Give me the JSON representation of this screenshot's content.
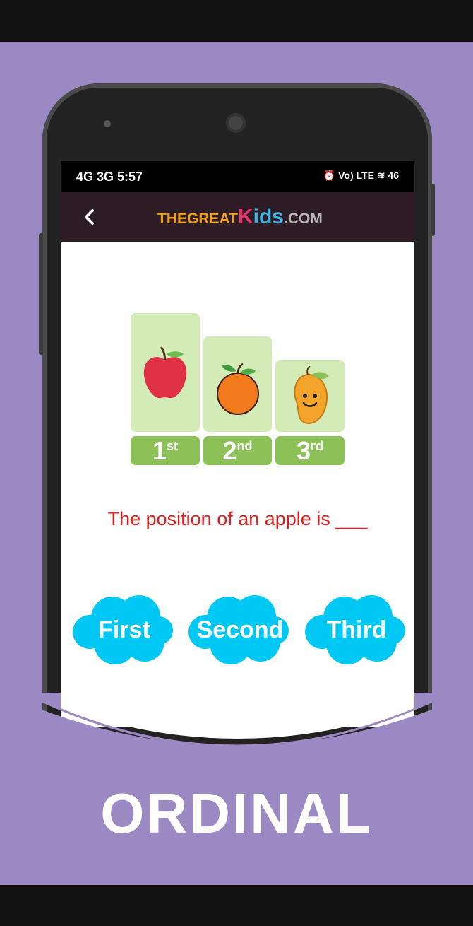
{
  "status_bar": {
    "left": "4G 3G 5:57",
    "right": "⏰ Vo) LTE ≋ 46"
  },
  "header": {
    "back_icon": "chevron-left-icon",
    "logo": {
      "part1": "THEGREAT",
      "k": "K",
      "ids": "ids",
      "com": ".COM"
    }
  },
  "fruits": [
    {
      "name": "apple",
      "rank": "1",
      "suffix": "st"
    },
    {
      "name": "orange",
      "rank": "2",
      "suffix": "nd"
    },
    {
      "name": "mango",
      "rank": "3",
      "suffix": "rd"
    }
  ],
  "question": "The position of an apple is ___",
  "answers": [
    "First",
    "Second",
    "Third"
  ],
  "title": "ORDINAL",
  "colors": {
    "background": "#9b89c4",
    "cloud": "#00c8f5",
    "podium": "#d3ebb7",
    "rank": "#8cc158",
    "question": "#e01e1e",
    "appbar": "#2e1c24"
  }
}
